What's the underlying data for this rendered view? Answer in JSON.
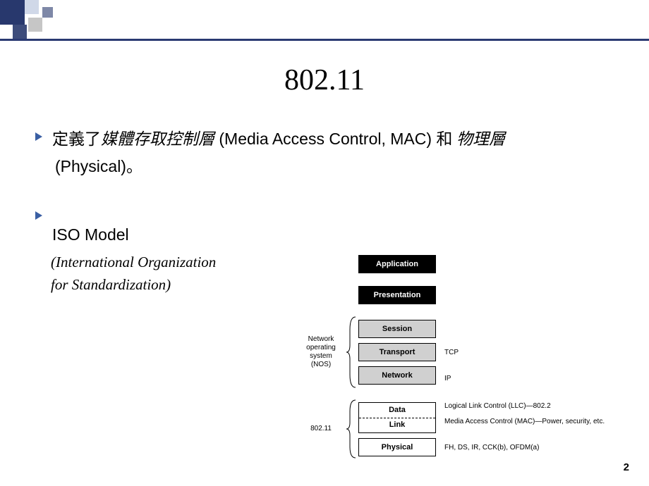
{
  "title": "802.11",
  "bullet1": {
    "pre": "定義了",
    "italic1": "媒體存取控制層",
    "paren1": " (Media Access Control, MAC) ",
    "and": "和 ",
    "italic2": "物理層",
    "post": "(Physical)。"
  },
  "bullet2": "ISO Model",
  "subtitle_line1": "(International Organization",
  "subtitle_line2": " for Standardization)",
  "diagram": {
    "left_group1": "Network\noperating\nsystem\n(NOS)",
    "left_group2": "802.11",
    "layers": {
      "application": "Application",
      "presentation": "Presentation",
      "session": "Session",
      "transport": "Transport",
      "network": "Network",
      "data": "Data",
      "link": "Link",
      "physical": "Physical"
    },
    "right": {
      "tcp": "TCP",
      "ip": "IP",
      "llc": "Logical Link Control (LLC)—802.2",
      "mac": "Media Access Control (MAC)—Power, security, etc.",
      "phy": "FH, DS, IR, CCK(b), OFDM(a)"
    }
  },
  "page_number": "2"
}
